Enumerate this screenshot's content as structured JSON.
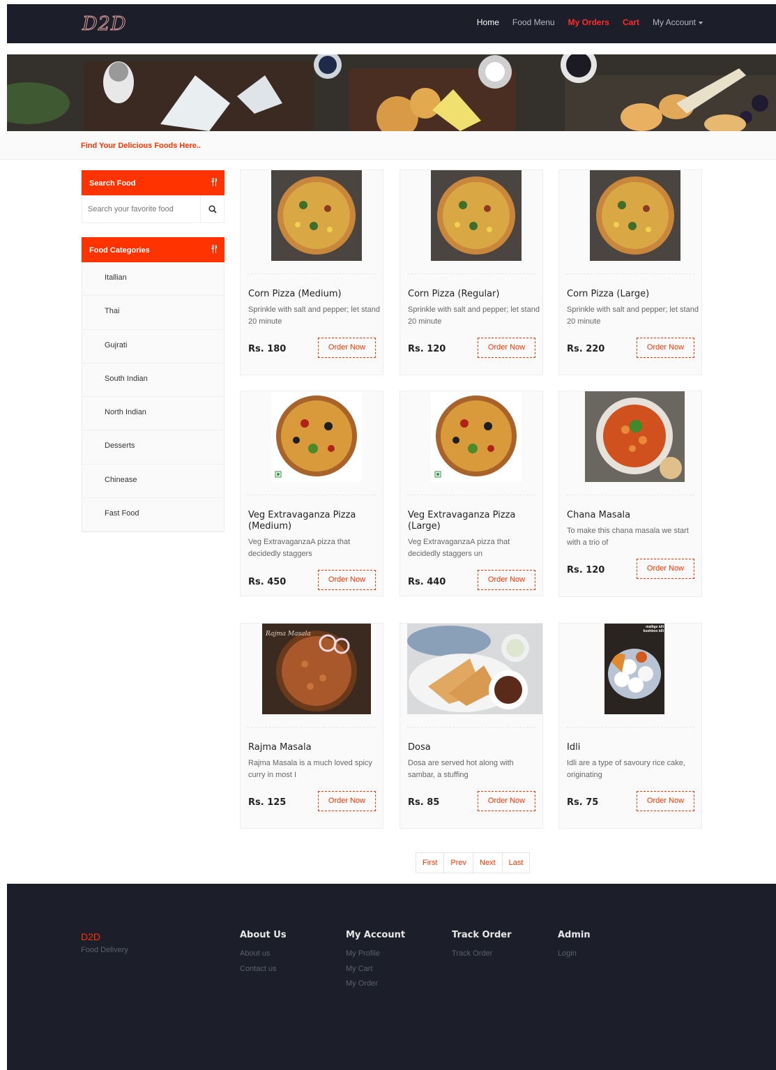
{
  "brand": {
    "logo": "D2D"
  },
  "nav": {
    "home": "Home",
    "food_menu": "Food Menu",
    "my_orders": "My Orders",
    "cart": "Cart",
    "my_account": "My Account"
  },
  "subheader": "Find Your Delicious Foods Here..",
  "sidebar": {
    "search_title": "Search Food",
    "search_placeholder": "Search your favorite food",
    "categories_title": "Food Categories",
    "categories": [
      "Itallian",
      "Thai",
      "Gujrati",
      "South Indian",
      "North Indian",
      "Desserts",
      "Chinease",
      "Fast Food"
    ]
  },
  "foods": [
    {
      "name": "Corn Pizza (Medium)",
      "desc": "Sprinkle with salt and pepper; let stand 20 minute",
      "price": "Rs. 180",
      "order": "Order Now",
      "image": "corn-pizza-image"
    },
    {
      "name": "Corn Pizza (Regular)",
      "desc": "Sprinkle with salt and pepper; let stand 20 minute",
      "price": "Rs. 120",
      "order": "Order Now",
      "image": "corn-pizza-image"
    },
    {
      "name": "Corn Pizza (Large)",
      "desc": "Sprinkle with salt and pepper; let stand 20 minute",
      "price": "Rs. 220",
      "order": "Order Now",
      "image": "corn-pizza-image"
    },
    {
      "name": "Veg Extravaganza Pizza (Medium)",
      "desc": "Veg ExtravaganzaA pizza that decidedly staggers",
      "price": "Rs. 450",
      "order": "Order Now",
      "image": "veg-pizza-image"
    },
    {
      "name": "Veg Extravaganza Pizza (Large)",
      "desc": "Veg ExtravaganzaA pizza that decidedly staggers un",
      "price": "Rs. 440",
      "order": "Order Now",
      "image": "veg-pizza-image"
    },
    {
      "name": "Chana Masala",
      "desc": "To make this chana masala we start with a trio of",
      "price": "Rs. 120",
      "order": "Order Now",
      "image": "chana-masala-image"
    },
    {
      "name": "Rajma Masala",
      "desc": "Rajma Masala is a much loved spicy curry in most I",
      "price": "Rs. 125",
      "order": "Order Now",
      "image": "rajma-masala-image",
      "image_caption": "Rajma Masala"
    },
    {
      "name": "Dosa",
      "desc": "Dosa are served hot along with sambar, a stuffing",
      "price": "Rs. 85",
      "order": "Order Now",
      "image": "dosa-image"
    },
    {
      "name": "Idli",
      "desc": "Idli are a type of savoury rice cake, originating",
      "price": "Rs. 75",
      "order": "Order Now",
      "image": "idli-image",
      "image_caption": "mallige idli kushboo idli"
    }
  ],
  "pagination": [
    "First",
    "Prev",
    "Next",
    "Last"
  ],
  "footer": {
    "brand": "D2D",
    "tagline": "Food Delivery",
    "about": {
      "title": "About Us",
      "links": [
        "About us",
        "Contact us"
      ]
    },
    "account": {
      "title": "My Account",
      "links": [
        "My Profile",
        "My Cart",
        "My Order"
      ]
    },
    "track": {
      "title": "Track Order",
      "links": [
        "Track Order"
      ]
    },
    "admin": {
      "title": "Admin",
      "links": [
        "Login"
      ]
    }
  },
  "colors": {
    "accent": "#ff3300",
    "nav_bg": "#1c1f29",
    "nav_active": "#ff2a2a"
  }
}
